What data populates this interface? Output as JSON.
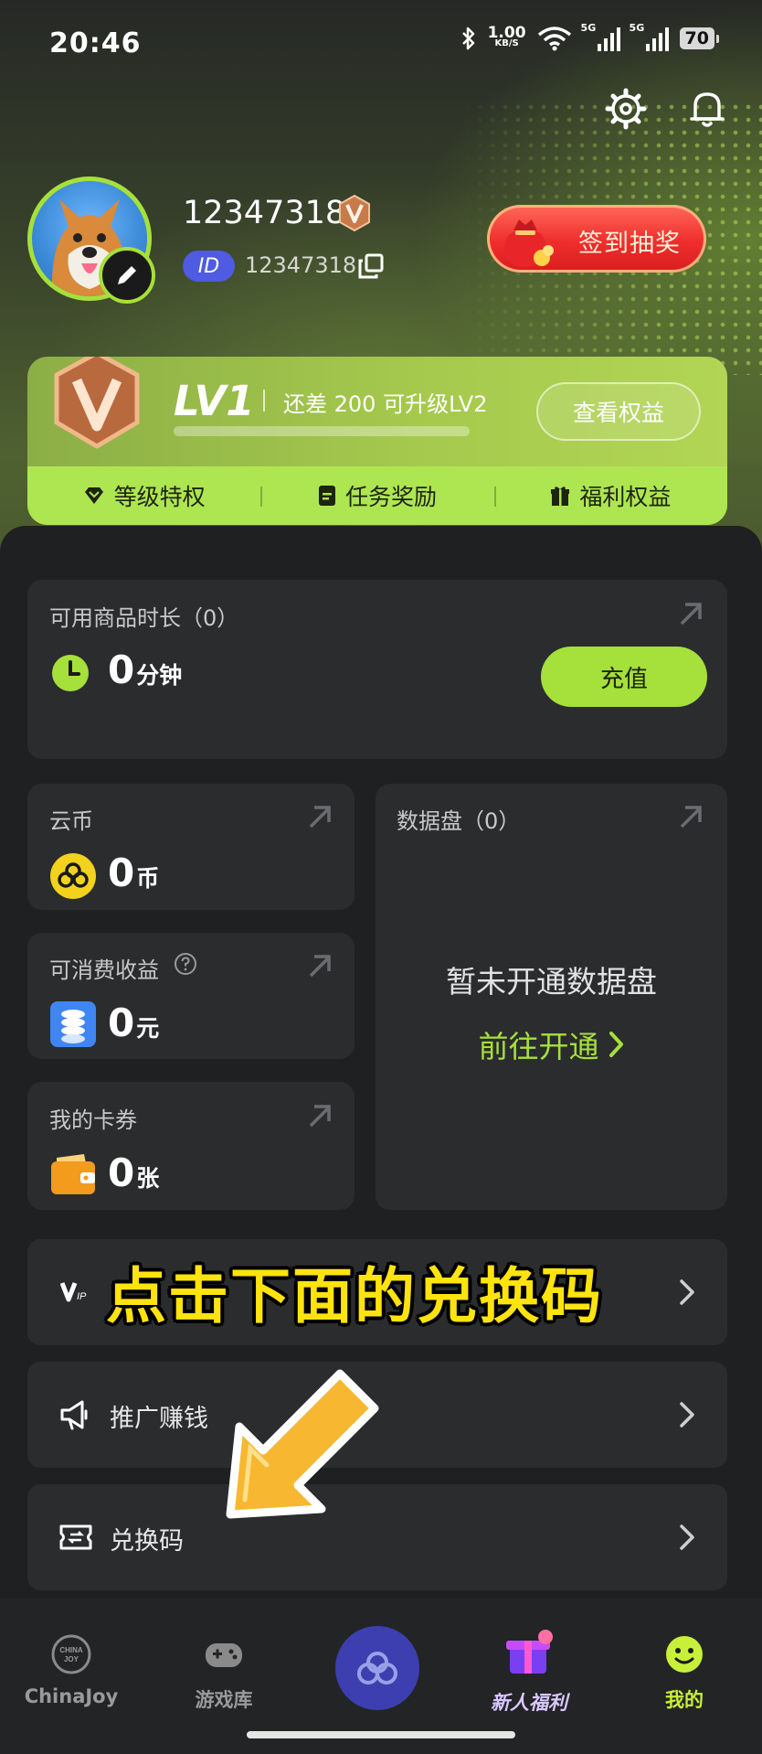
{
  "status_bar": {
    "time": "20:46",
    "net_speed_value": "1.00",
    "net_speed_unit": "KB/S",
    "sig1_tag": "5G",
    "sig2_tag": "5G",
    "battery": "70"
  },
  "header": {
    "settings_icon": "gear-icon",
    "bell_icon": "bell-icon"
  },
  "profile": {
    "username": "12347318",
    "id_chip": "ID",
    "id_value": "12347318",
    "sign_in_label": "签到抽奖"
  },
  "level": {
    "title": "LV1",
    "need_text": "还差 200 可升级LV2",
    "progress_fraction": 0.0,
    "view_benefits_label": "查看权益",
    "tabs": [
      {
        "label": "等级特权",
        "icon": "diamond-icon"
      },
      {
        "label": "任务奖励",
        "icon": "clipboard-icon"
      },
      {
        "label": "福利权益",
        "icon": "gift-icon"
      }
    ]
  },
  "time_card": {
    "title": "可用商品时长（0）",
    "value": "0",
    "unit": "分钟",
    "recharge_label": "充值"
  },
  "coins_card": {
    "title": "云币",
    "value": "0",
    "unit": "币"
  },
  "earnings_card": {
    "title": "可消费收益",
    "value": "0",
    "unit": "元"
  },
  "coupons_card": {
    "title": "我的卡券",
    "value": "0",
    "unit": "张"
  },
  "disk_card": {
    "title": "数据盘（0）",
    "empty_text": "暂未开通数据盘",
    "open_link": "前往开通"
  },
  "menu": [
    {
      "label": "",
      "icon": "vip-icon"
    },
    {
      "label": "推广赚钱",
      "icon": "megaphone-icon"
    },
    {
      "label": "兑换码",
      "icon": "ticket-icon"
    }
  ],
  "overlay": {
    "caption": "点击下面的兑换码"
  },
  "tabbar": {
    "items": [
      {
        "label": "ChinaJoy",
        "icon": "chinajoy-logo-icon"
      },
      {
        "label": "游戏库",
        "icon": "gamepad-icon"
      },
      {
        "label": "",
        "icon": "cloud-icon"
      },
      {
        "label": "新人福利",
        "icon": "gift-box-icon"
      },
      {
        "label": "我的",
        "icon": "smiley-icon"
      }
    ],
    "active_color": "#c8ef3a",
    "accent_color": "#a6e03a"
  }
}
